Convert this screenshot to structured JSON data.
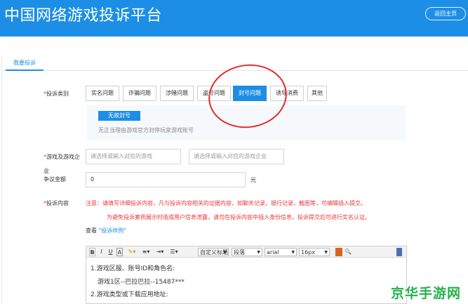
{
  "header": {
    "site_title": "中国网络游戏投诉平台",
    "home_button": "返回主页"
  },
  "tabs": [
    {
      "label": "我要投诉",
      "active": true
    }
  ],
  "form": {
    "category_label": "投诉类别",
    "required_mark": "*",
    "categories": [
      "实名问题",
      "诈骗问题",
      "涉赌问题",
      "盗号问题",
      "封号问题",
      "诱导消费",
      "其他"
    ],
    "active_category": "封号问题",
    "sub_option": {
      "tag": "无故封号",
      "description": "无正当理由游戏官方封停玩家游戏账号"
    },
    "game_label": "游戏及游戏企",
    "game_label_cont": "业",
    "game_placeholder": "请选择或输入对应的游戏",
    "company_placeholder": "请选择或输入对应的游戏企业",
    "amount_label": "争议金额",
    "amount_value": "0",
    "amount_unit": "元",
    "content_label": "投诉内容",
    "notice_label": "注意：",
    "notice_line1": "请填写详细投诉内容，凡与投诉内容相关的证据内容，如聊天记录，银行记录，截图等，可编辑插入提交。",
    "notice_line2": "为避免投诉案例展示时造成用户信息泄露，请勿在投诉内容中插入身份信息。投诉提交后可进行实名认证。",
    "view_prefix": "查看",
    "view_link": "\"投诉样例\""
  },
  "editor": {
    "toolbar": {
      "bold": "B",
      "italic": "I",
      "underline": "U",
      "font_color": "A",
      "custom_title": "自定义标题",
      "paragraph": "段落",
      "font": "arial",
      "size": "16px"
    },
    "lines": [
      "1.游戏区服、账号ID和角色名:",
      "游戏1区--巴拉巴拉--15487***",
      "2.游戏类型或下载应用地址:"
    ]
  },
  "watermark": "京华手游网",
  "colors": {
    "header_blue": "#1d8ee6",
    "required_red": "#e33333",
    "annotation_red": "#e52b2b",
    "watermark_green": "#21b24b"
  }
}
